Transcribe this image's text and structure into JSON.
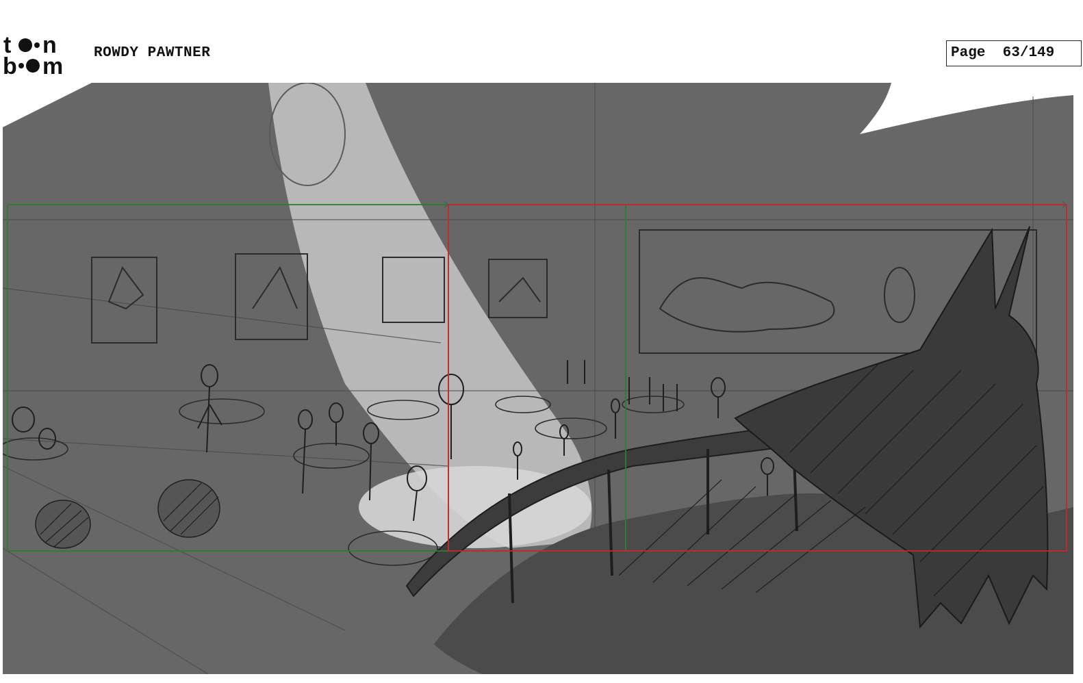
{
  "header": {
    "logo_text_top": "to•n",
    "logo_text_bottom": "b•om",
    "project_title": "ROWDY PAWTNER",
    "page_label": "Page",
    "page_number": "63/149"
  },
  "colors": {
    "panel_background": "#676767",
    "sketch_lines": "#2a2a2a",
    "spotlight": "#bdbdbd",
    "foreground_shadow": "#474747",
    "camera_frame_start": "#2e7d32",
    "camera_frame_end": "#c62828"
  },
  "icons": {
    "logo": "toonboom-logo"
  }
}
